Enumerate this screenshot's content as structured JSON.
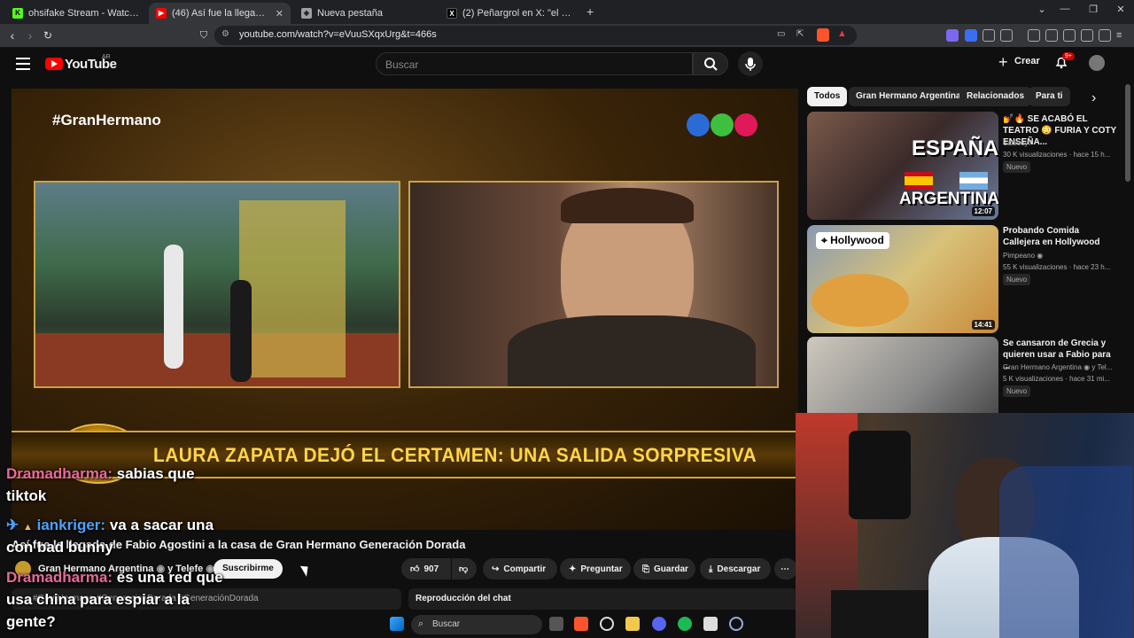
{
  "browser": {
    "tabs": [
      {
        "label": "ohsifake Stream - Watch Live on Kick",
        "icon": "kick-icon",
        "color": "#53fc18"
      },
      {
        "label": "(46) Así fue la llegada de Fabi",
        "icon": "youtube-icon",
        "color": "#ff0000"
      },
      {
        "label": "Nueva pestaña",
        "icon": "brave-shield-icon",
        "color": "#9aa0a6"
      },
      {
        "label": "(2) Peñargrol en X: \"el mano a mano",
        "icon": "x-logo-icon",
        "color": "#ffffff"
      }
    ],
    "new_tab": "+",
    "url": "youtube.com/watch?v=eVuuSXqxUrg&t=466s"
  },
  "youtube": {
    "logo_text": "YouTube",
    "region": "AR",
    "search_placeholder": "Buscar",
    "create_label": "Crear",
    "notifications_badge": "9+"
  },
  "video": {
    "hashtag": "#GranHermano",
    "lower_third": "LAURA ZAPATA DEJÓ EL CERTAMEN: UNA SALIDA SORPRESIVA",
    "logo_dot_colors": [
      "#2a6bd6",
      "#3fbf3f",
      "#e0195a"
    ],
    "title": "Así fue la llegada de Fabio Agostini a la casa de Gran Hermano Generación Dorada",
    "channel": "Gran Hermano Argentina",
    "channel_suffix": "y Telefe",
    "subscribe_label": "Suscribirme",
    "likes": "907",
    "share_label": "Compartir",
    "ask_label": "Preguntar",
    "save_label": "Guardar",
    "download_label": "Descargar",
    "description_tags": "#GranHermano #GeneracionDorada #GeneraciónDorada",
    "chat_replay_label": "Reproducción del chat"
  },
  "chat_overlay": [
    {
      "user": "Dramadharma",
      "line1": "sabias que",
      "line2": "tiktok"
    },
    {
      "user": "iankriger",
      "line1": "va a sacar una",
      "line2": "con bad bunny"
    },
    {
      "user": "Dramadharma",
      "line1": "es una red que",
      "line2": "usa china para espiar a la",
      "line3": "gente?"
    }
  ],
  "sidebar": {
    "chips": [
      "Todos",
      "Gran Hermano Argentina",
      "Relacionados",
      "Para ti"
    ],
    "videos": [
      {
        "title": "💅🔥 SE ACABÓ EL TEATRO 😳 FURIA Y COTY ENSEÑA...",
        "channel": "Salseoy?",
        "meta": "30 K visualizaciones · hace 15 h...",
        "badge": "Nuevo",
        "duration": "12:07",
        "thumb_text_1": "ESPAÑA",
        "thumb_text_2": "ARGENTINA"
      },
      {
        "title": "Probando Comida Callejera en Hollywood",
        "channel": "Pimpeano",
        "meta": "55 K visualizaciones · hace 23 h...",
        "badge": "Nuevo",
        "duration": "14:41",
        "thumb_text_1": "Hollywood"
      },
      {
        "title": "Se cansaron de Grecia y quieren usar a Fabio para ...",
        "channel": "Gran Hermano Argentina",
        "channel_suffix": "y Tel...",
        "meta": "5 K visualizaciones · hace 31 mi...",
        "badge": "Nuevo"
      }
    ]
  },
  "taskbar": {
    "search_placeholder": "Buscar"
  }
}
